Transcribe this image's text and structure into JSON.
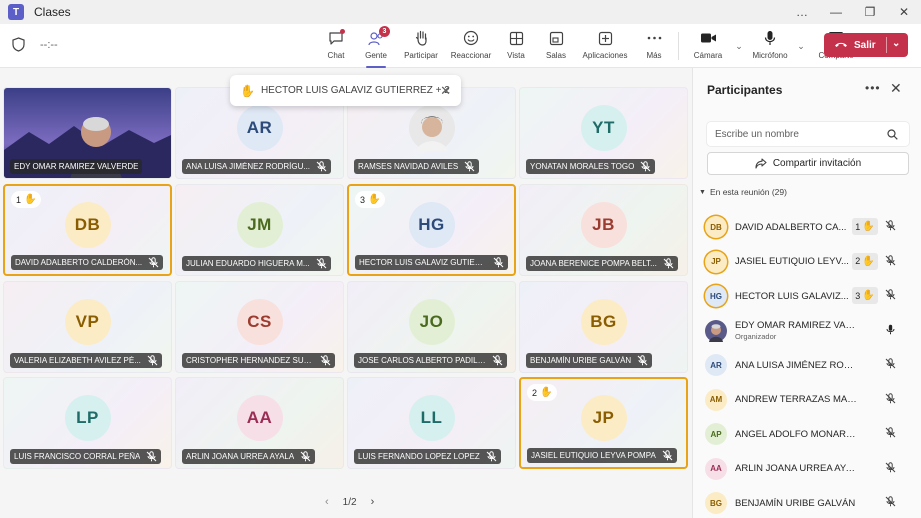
{
  "window": {
    "title": "Clases",
    "controls": [
      "…",
      "—",
      "❐",
      "✕"
    ]
  },
  "toolbar": {
    "timer": "--:--",
    "items": [
      {
        "label": "Chat",
        "icon": "chat-icon"
      },
      {
        "label": "Gente",
        "icon": "people-icon",
        "badge": "3"
      },
      {
        "label": "Participar",
        "icon": "raise-hand-icon"
      },
      {
        "label": "Reaccionar",
        "icon": "react-icon"
      },
      {
        "label": "Vista",
        "icon": "view-icon"
      },
      {
        "label": "Salas",
        "icon": "rooms-icon"
      },
      {
        "label": "Aplicaciones",
        "icon": "apps-icon"
      },
      {
        "label": "Más",
        "icon": "more-icon"
      },
      {
        "label": "Cámara",
        "icon": "camera-icon"
      },
      {
        "label": "Micrófono",
        "icon": "mic-icon"
      },
      {
        "label": "Comparte",
        "icon": "share-icon"
      }
    ],
    "leave_label": "Salir"
  },
  "toast": {
    "text": "HECTOR LUIS GALAVIZ GUTIERREZ + 2"
  },
  "tiles": [
    {
      "name": "EDY OMAR RAMIREZ VALVERDE",
      "photo": true,
      "muted": false
    },
    {
      "name": "ANA LUISA JIMÉNEZ RODRÍGU...",
      "initials": "AR",
      "bg": "#dfe8f5",
      "fg": "#2c4a7a",
      "muted": true
    },
    {
      "name": "RAMSES NAVIDAD AVILES",
      "photo2": true,
      "muted": true
    },
    {
      "name": "YONATAN MORALES TOGO",
      "initials": "YT",
      "bg": "#d6f0ef",
      "fg": "#1e6b67",
      "muted": true
    },
    {
      "name": "DAVID ADALBERTO CALDERÓN...",
      "initials": "DB",
      "bg": "#fbecc6",
      "fg": "#8a5d00",
      "muted": true,
      "hand": "1"
    },
    {
      "name": "JULIAN EDUARDO HIGUERA M...",
      "initials": "JM",
      "bg": "#e3efd5",
      "fg": "#4a6b1f",
      "muted": true
    },
    {
      "name": "HECTOR LUIS GALAVIZ GUTIER...",
      "initials": "HG",
      "bg": "#dfe8f5",
      "fg": "#2c4a7a",
      "muted": true,
      "hand": "3"
    },
    {
      "name": "JOANA BERENICE POMPA BELT...",
      "initials": "JB",
      "bg": "#f8e0dc",
      "fg": "#9c3b2f",
      "muted": true
    },
    {
      "name": "VALERIA ELIZABETH AVILEZ PÉ...",
      "initials": "VP",
      "bg": "#fbecc6",
      "fg": "#8a5d00",
      "muted": true
    },
    {
      "name": "CRISTOPHER HERNANDEZ SUB...",
      "initials": "CS",
      "bg": "#f8e0dc",
      "fg": "#9c3b2f",
      "muted": true
    },
    {
      "name": "JOSE CARLOS ALBERTO PADILL...",
      "initials": "JO",
      "bg": "#e3efd5",
      "fg": "#4a6b1f",
      "muted": true
    },
    {
      "name": "BENJAMÍN URIBE GALVÁN",
      "initials": "BG",
      "bg": "#fbecc6",
      "fg": "#8a5d00",
      "muted": true
    },
    {
      "name": "LUIS FRANCISCO CORRAL PEÑA",
      "initials": "LP",
      "bg": "#d6f0ef",
      "fg": "#1e6b67",
      "muted": true
    },
    {
      "name": "ARLIN JOANA URREA AYALA",
      "initials": "AA",
      "bg": "#f7dfe8",
      "fg": "#9b2d55",
      "muted": true
    },
    {
      "name": "LUIS FERNANDO LOPEZ LOPEZ",
      "initials": "LL",
      "bg": "#d6f0ef",
      "fg": "#1e6b67",
      "muted": true
    },
    {
      "name": "JASIEL EUTIQUIO LEYVA POMPA",
      "initials": "JP",
      "bg": "#fbecc6",
      "fg": "#8a5d00",
      "muted": true,
      "hand": "2"
    }
  ],
  "pager": {
    "text": "1/2"
  },
  "panel": {
    "title": "Participantes",
    "search_placeholder": "Escribe un nombre",
    "invite_label": "Compartir invitación",
    "section_label": "En esta reunión (29)",
    "participants": [
      {
        "name": "DAVID ADALBERTO CA...",
        "initials": "DB",
        "bg": "#fbecc6",
        "fg": "#8a5d00",
        "hand": "1",
        "muted": true,
        "highlight": true
      },
      {
        "name": "JASIEL EUTIQUIO LEYV...",
        "initials": "JP",
        "bg": "#fbecc6",
        "fg": "#8a5d00",
        "hand": "2",
        "muted": true,
        "highlight": true
      },
      {
        "name": "HECTOR LUIS GALAVIZ...",
        "initials": "HG",
        "bg": "#dfe8f5",
        "fg": "#2c4a7a",
        "hand": "3",
        "muted": true,
        "highlight": true
      },
      {
        "name": "EDY OMAR RAMIREZ VALVERDE",
        "role": "Organizador",
        "photo": true,
        "muted": false
      },
      {
        "name": "ANA LUISA JIMÉNEZ RODRÍG...",
        "initials": "AR",
        "bg": "#dfe8f5",
        "fg": "#2c4a7a",
        "muted": true
      },
      {
        "name": "ANDREW TERRAZAS MARISCAL",
        "initials": "AM",
        "bg": "#fbecc6",
        "fg": "#8a5d00",
        "muted": true
      },
      {
        "name": "ANGEL ADOLFO MONARREZ ...",
        "initials": "AP",
        "bg": "#e3efd5",
        "fg": "#4a6b1f",
        "muted": true
      },
      {
        "name": "ARLIN JOANA URREA AYALA",
        "initials": "AA",
        "bg": "#f7dfe8",
        "fg": "#9b2d55",
        "muted": true
      },
      {
        "name": "BENJAMÍN URIBE GALVÁN",
        "initials": "BG",
        "bg": "#fbecc6",
        "fg": "#8a5d00",
        "muted": true
      }
    ]
  }
}
